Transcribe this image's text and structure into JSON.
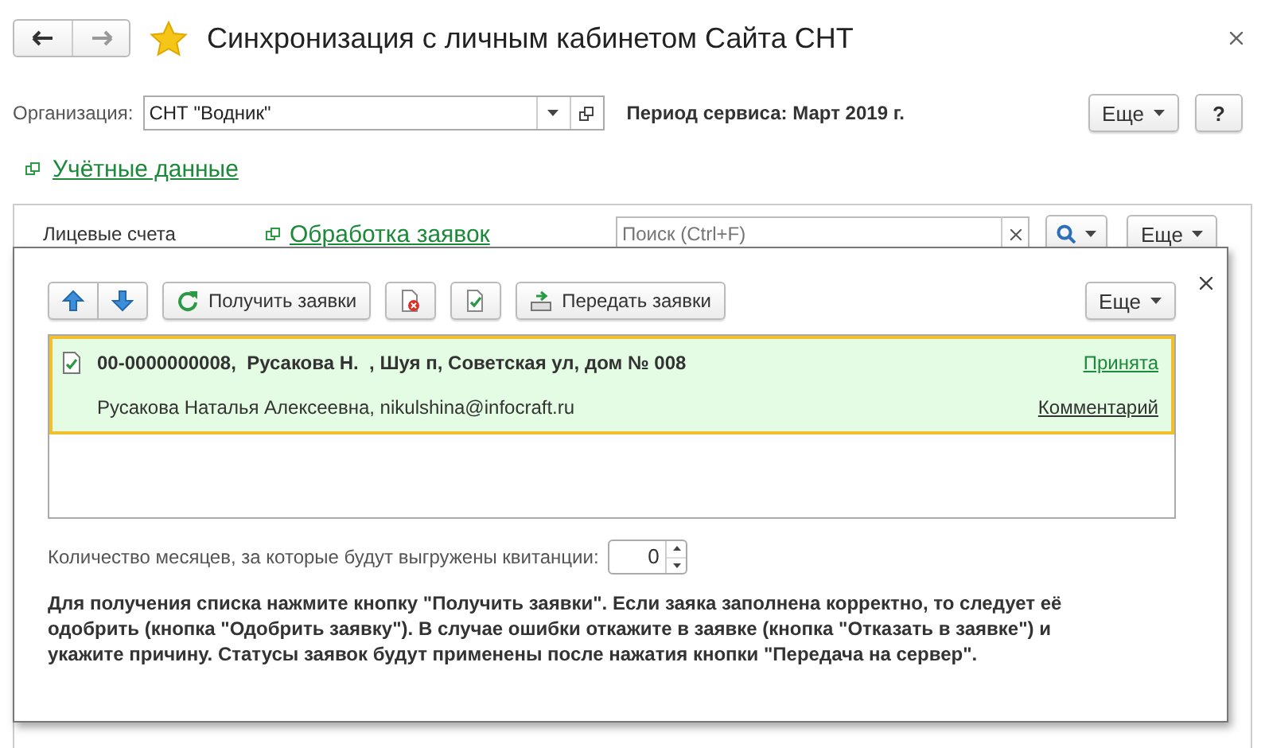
{
  "window": {
    "title": "Синхронизация с личным кабинетом Сайта СНТ",
    "favorite": true
  },
  "organization": {
    "label": "Организация:",
    "value": "СНТ \"Водник\""
  },
  "period": "Период сервиса: Март 2019 г.",
  "header_buttons": [
    {
      "kind": "more",
      "label": "Еще"
    },
    {
      "kind": "help",
      "label": "?"
    }
  ],
  "link": "Учётные данные",
  "panel": {
    "label": "Лицевые счета",
    "link": "Обработка заявок",
    "search": {
      "placeholder": "Поиск (Ctrl+F)"
    },
    "more": "Еще"
  },
  "dialog": {
    "toolbar": [
      {
        "kind": "up"
      },
      {
        "kind": "down"
      },
      {
        "kind": "refresh",
        "label": "Получить заявки"
      },
      {
        "kind": "reject"
      },
      {
        "kind": "approve"
      },
      {
        "kind": "send",
        "label": "Передать заявки"
      }
    ],
    "more": "Еще",
    "requests": [
      {
        "title": "00-0000000008,  Русакова Н.  , Шуя п, Советская ул, дом № 008",
        "subtitle": "Русакова Наталья Алексеевна, nikulshina@infocraft.ru",
        "status": "Принята",
        "comment": "Комментарий",
        "selected": true
      }
    ],
    "months": {
      "label": "Количество месяцев, за которые будут выгружены квитанции:",
      "value": "0"
    },
    "hint": "Для получения списка нажмите кнопку \"Получить заявки\". Если заяка заполнена корректно, то следует её одобрить (кнопка \"Одобрить заявку\"). В случае ошибки откажите в заявке (кнопка \"Отказать в заявке\") и укажите причину. Статусы заявок будут применены после нажатия кнопки \"Передача на сервер\"."
  }
}
